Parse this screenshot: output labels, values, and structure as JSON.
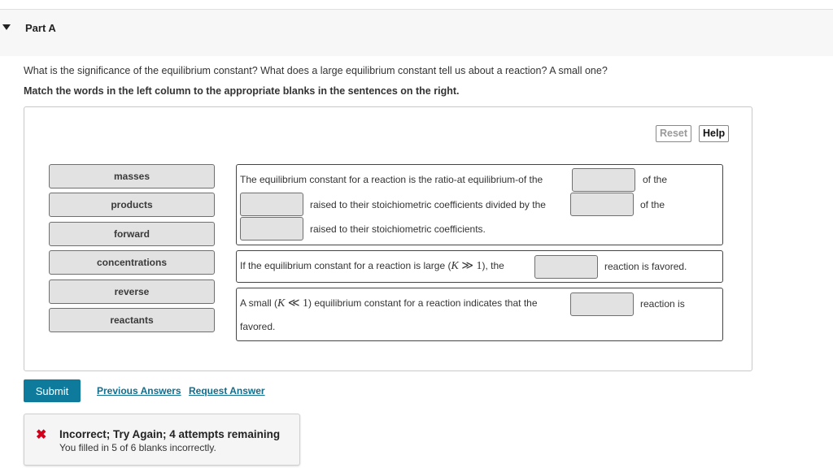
{
  "part": {
    "title": "Part A",
    "expanded": true
  },
  "question": "What is the significance of the equilibrium constant? What does a large equilibrium constant tell us about a reaction? A small one?",
  "instruction": "Match the words in the left column to the appropriate blanks in the sentences on the right.",
  "toolbar": {
    "reset_label": "Reset",
    "help_label": "Help"
  },
  "word_bank": [
    "masses",
    "products",
    "forward",
    "concentrations",
    "reverse",
    "reactants"
  ],
  "sentences": {
    "s1": {
      "line1_text": "The equilibrium constant for a reaction is the ratio-at equilibrium-of the",
      "line1_after": "of the",
      "line2_text": "raised to their stoichiometric coefficients divided by the",
      "line2_after": "of the",
      "line3_text": "raised to their stoichiometric coefficients."
    },
    "s2": {
      "before": "If the equilibrium constant for a reaction is large (",
      "math_var": "K",
      "math_rel": "≫",
      "math_num": "1",
      "after_math": "), the",
      "after_blank": "reaction is favored."
    },
    "s3": {
      "before": "A small (",
      "math_var": "K",
      "math_rel": "≪",
      "math_num": "1",
      "after_math": ") equilibrium constant for a reaction indicates that the",
      "after_blank": "reaction is",
      "line2": "favored."
    }
  },
  "actions": {
    "submit_label": "Submit",
    "previous_answers_label": "Previous Answers",
    "request_answer_label": "Request Answer"
  },
  "feedback": {
    "icon": "x-icon",
    "title": "Incorrect; Try Again; 4 attempts remaining",
    "detail": "You filled in 5 of 6 blanks incorrectly."
  }
}
